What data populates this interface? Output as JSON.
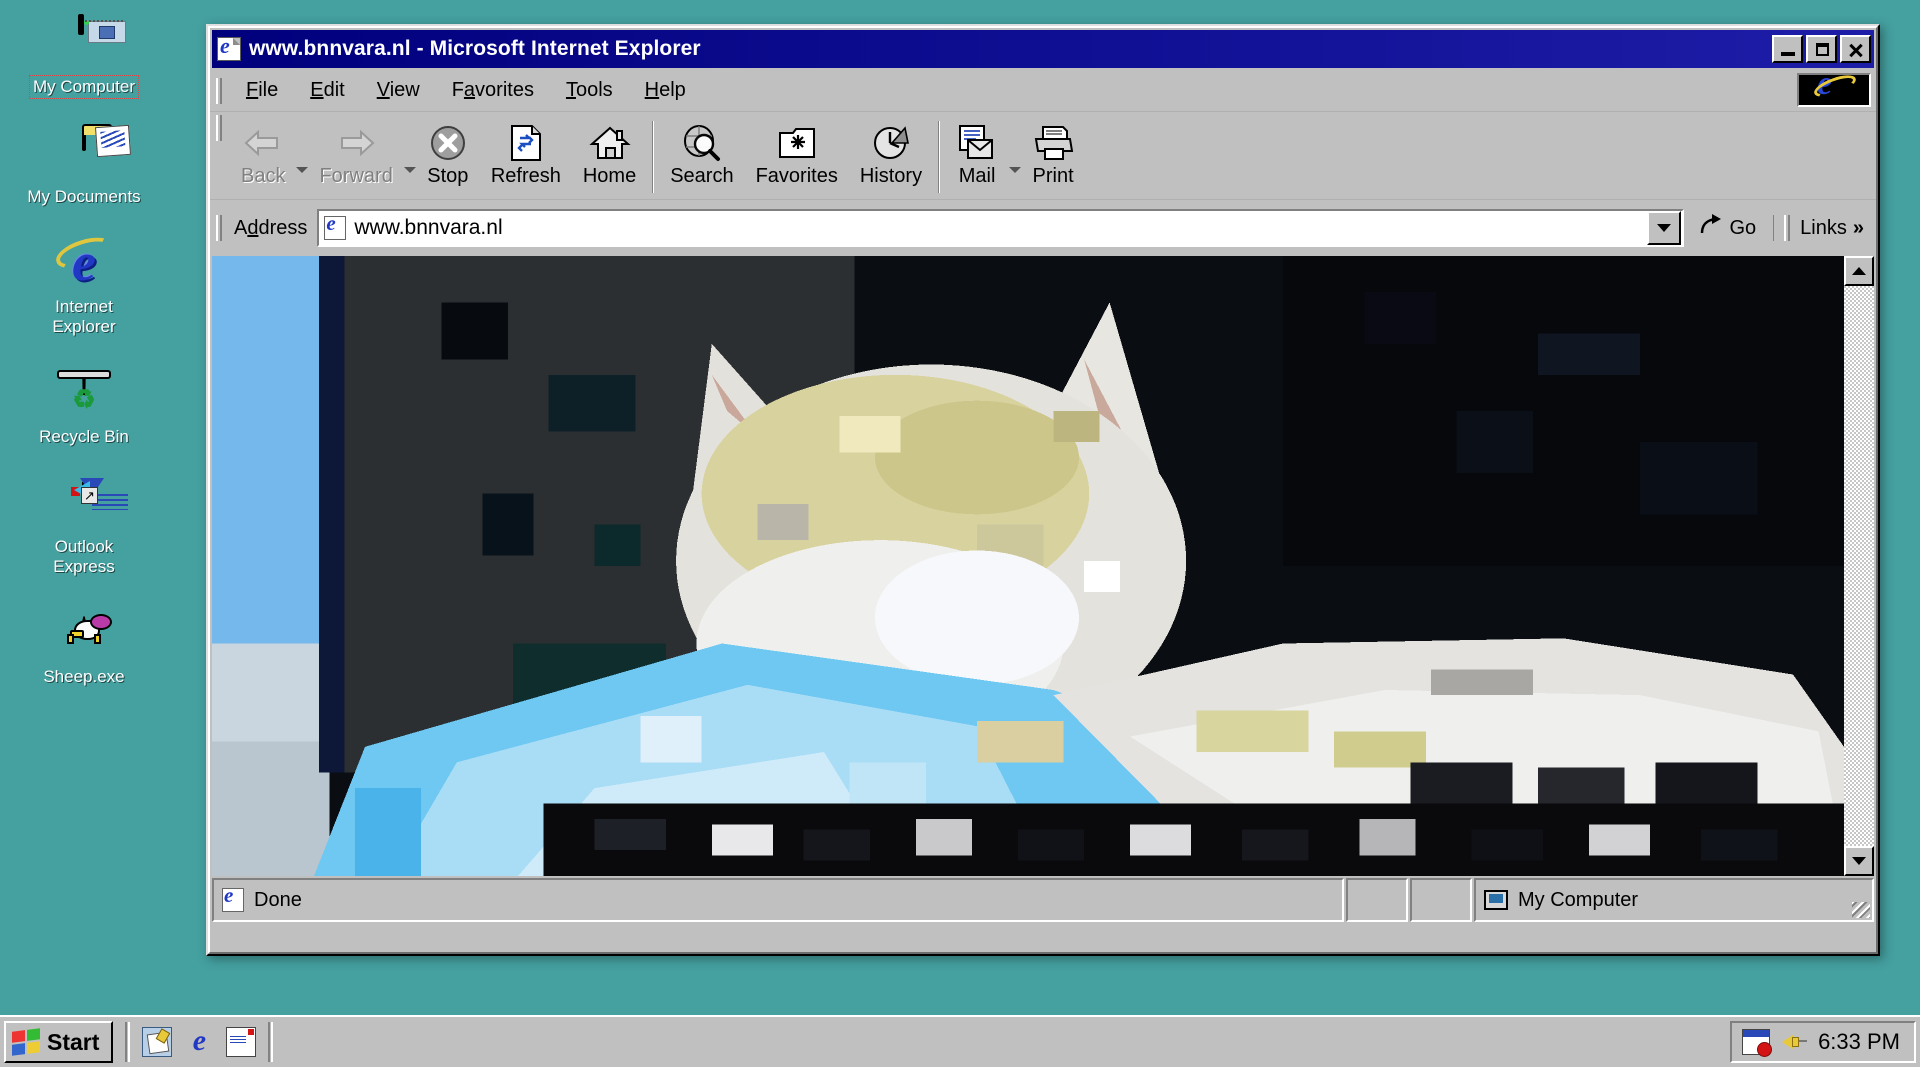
{
  "desktop": {
    "background_color": "#45a0a0",
    "icons": [
      {
        "label": "My Computer",
        "icon": "my-computer-icon",
        "selected": true
      },
      {
        "label": "My Documents",
        "icon": "my-documents-folder-icon",
        "selected": false
      },
      {
        "label": "Internet\nExplorer",
        "icon": "internet-explorer-icon",
        "selected": false
      },
      {
        "label": "Recycle Bin",
        "icon": "recycle-bin-icon",
        "selected": false
      },
      {
        "label": "Outlook\nExpress",
        "icon": "outlook-express-icon",
        "selected": false
      },
      {
        "label": "Sheep.exe",
        "icon": "sheep-icon",
        "selected": false
      }
    ]
  },
  "window": {
    "title": "www.bnnvara.nl - Microsoft Internet Explorer",
    "title_icon": "internet-explorer-page-icon",
    "titlebar_color": "#00007d",
    "buttons": {
      "minimize": "Minimize",
      "maximize": "Maximize",
      "close": "Close"
    },
    "menu": [
      {
        "label": "File",
        "accel": "F"
      },
      {
        "label": "Edit",
        "accel": "E"
      },
      {
        "label": "View",
        "accel": "V"
      },
      {
        "label": "Favorites",
        "accel": "a"
      },
      {
        "label": "Tools",
        "accel": "T"
      },
      {
        "label": "Help",
        "accel": "H"
      }
    ],
    "toolbar": [
      {
        "label": "Back",
        "icon": "back-arrow-icon",
        "disabled": true,
        "dropdown": true
      },
      {
        "label": "Forward",
        "icon": "forward-arrow-icon",
        "disabled": true,
        "dropdown": true
      },
      {
        "label": "Stop",
        "icon": "stop-icon",
        "disabled": false,
        "dropdown": false
      },
      {
        "label": "Refresh",
        "icon": "refresh-icon",
        "disabled": false,
        "dropdown": false
      },
      {
        "label": "Home",
        "icon": "home-icon",
        "disabled": false,
        "dropdown": false
      },
      {
        "label": "Search",
        "icon": "search-icon",
        "disabled": false,
        "dropdown": false
      },
      {
        "label": "Favorites",
        "icon": "favorites-star-icon",
        "disabled": false,
        "dropdown": false
      },
      {
        "label": "History",
        "icon": "history-clock-icon",
        "disabled": false,
        "dropdown": false
      },
      {
        "label": "Mail",
        "icon": "mail-icon",
        "disabled": false,
        "dropdown": true
      },
      {
        "label": "Print",
        "icon": "printer-icon",
        "disabled": false,
        "dropdown": false
      }
    ],
    "address": {
      "label": "Address",
      "accel": "d",
      "value": "www.bnnvara.nl",
      "placeholder": "",
      "icon": "page-icon",
      "go_label": "Go",
      "go_icon": "go-arrow-icon",
      "links_label": "Links",
      "links_icon": "chevron-double-right-icon",
      "dropdown_icon": "chevron-down-icon"
    },
    "content": {
      "description": "Pixelated low-resolution photograph of a cat lying on a computer keyboard",
      "scrollbar": {
        "up_icon": "scroll-up-arrow-icon",
        "down_icon": "scroll-down-arrow-icon"
      }
    },
    "statusbar": {
      "status_text": "Done",
      "status_icon": "internet-explorer-page-icon",
      "zone_text": "My Computer",
      "zone_icon": "my-computer-zone-icon"
    }
  },
  "taskbar": {
    "start_label": "Start",
    "start_icon": "windows-flag-icon",
    "quick_launch": [
      {
        "name": "show-desktop-icon",
        "title": "Show Desktop"
      },
      {
        "name": "internet-explorer-icon",
        "title": "Launch Internet Explorer"
      },
      {
        "name": "outlook-express-icon",
        "title": "Launch Outlook Express"
      }
    ],
    "tray": [
      {
        "name": "scheduled-tasks-icon"
      },
      {
        "name": "volume-speaker-icon"
      }
    ],
    "clock": "6:33 PM"
  }
}
